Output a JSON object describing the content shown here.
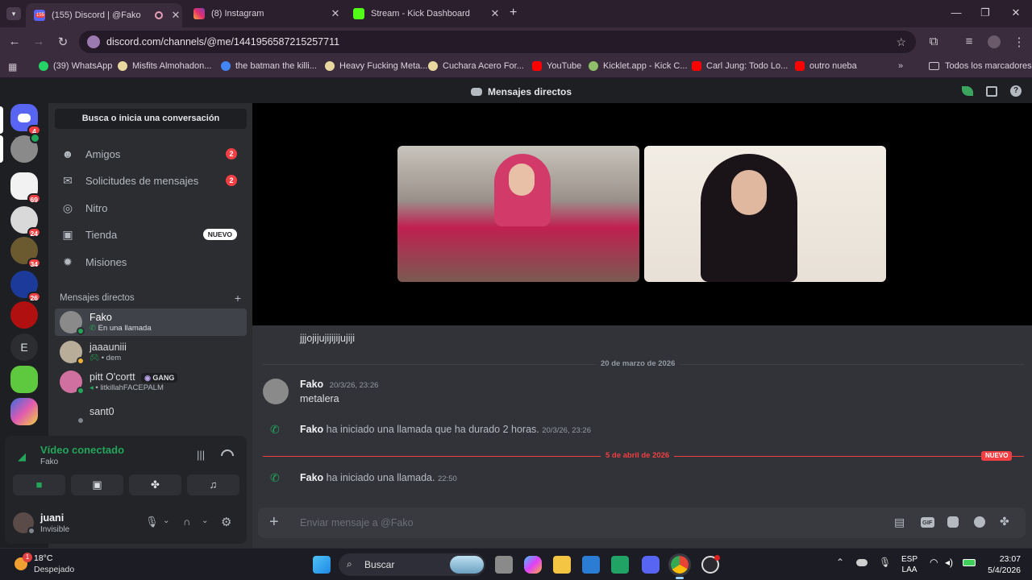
{
  "browser": {
    "tabs": [
      {
        "title": "(155) Discord | @Fako",
        "active": true,
        "favicon": "discord-icon"
      },
      {
        "title": "(8) Instagram",
        "active": false,
        "favicon": "instagram-icon"
      },
      {
        "title": "Stream - Kick Dashboard",
        "active": false,
        "favicon": "kick-icon"
      }
    ],
    "url": "discord.com/channels/@me/1441956587215257711",
    "bookmarks": [
      {
        "label": "(39) WhatsApp",
        "color": "#25d366"
      },
      {
        "label": "Misfits Almohadon...",
        "color": "#e8d8a0"
      },
      {
        "label": "the batman the killi...",
        "color": "#4285f4"
      },
      {
        "label": "Heavy Fucking Meta...",
        "color": "#e8d8a0"
      },
      {
        "label": "Cuchara Acero For...",
        "color": "#e8d8a0"
      },
      {
        "label": "YouTube",
        "color": "#ff0000"
      },
      {
        "label": "Kicklet.app - Kick C...",
        "color": "#8fbf6a"
      },
      {
        "label": "Carl Jung: Todo Lo...",
        "color": "#ff0000"
      },
      {
        "label": "outro nueba",
        "color": "#ff0000"
      }
    ],
    "all_bookmarks": "Todos los marcadores"
  },
  "discord": {
    "header_title": "Mensajes directos",
    "search_label": "Busca o inicia una conversación",
    "guild_badges": [
      "4",
      "69",
      "24",
      "34",
      "26"
    ],
    "guild_letter": "E",
    "nav": [
      {
        "label": "Amigos",
        "badge": "2",
        "icon": "friends-icon"
      },
      {
        "label": "Solicitudes de mensajes",
        "badge": "2",
        "icon": "mail-icon"
      },
      {
        "label": "Nitro",
        "badge": "",
        "icon": "nitro-icon"
      },
      {
        "label": "Tienda",
        "badge": "NUEVO",
        "icon": "shop-icon"
      },
      {
        "label": "Misiones",
        "badge": "",
        "icon": "quests-icon"
      }
    ],
    "dm_header": "Mensajes directos",
    "dms": [
      {
        "name": "Fako",
        "sub": "En una llamada",
        "selected": true
      },
      {
        "name": "jaaauniii",
        "sub": "• dem",
        "selected": false
      },
      {
        "name": "pitt O'cortt",
        "tag": "GANG",
        "sub": "• litkillahFACEPALM",
        "selected": false
      },
      {
        "name": "sant0",
        "sub": "",
        "selected": false
      }
    ],
    "voice": {
      "status": "Vídeo conectado",
      "channel": "Fako"
    },
    "user": {
      "name": "juani",
      "status": "Invisible"
    },
    "messages": {
      "prev_text": "jjjojijujijijijujiji",
      "date1": "20 de marzo de 2026",
      "msg_author": "Fako",
      "msg_time": "20/3/26, 23:26",
      "msg_text": "metalera",
      "call1_author": "Fako",
      "call1_text": "ha iniciado una llamada que ha durado 2 horas.",
      "call1_time": "20/3/26, 23:26",
      "date2": "5 de abril de 2026",
      "new_label": "NUEVO",
      "call2_author": "Fako",
      "call2_text": "ha iniciado una llamada.",
      "call2_time": "22:50"
    },
    "composer_placeholder": "Enviar mensaje a @Fako"
  },
  "taskbar": {
    "weather_temp": "18°C",
    "weather_desc": "Despejado",
    "weather_badge": "1",
    "search_label": "Buscar",
    "lang1": "ESP",
    "lang2": "LAA",
    "time": "23:07",
    "date": "5/4/2026"
  },
  "colors": {
    "accent": "#5865f2",
    "online": "#23a55a",
    "danger": "#f23f43"
  }
}
